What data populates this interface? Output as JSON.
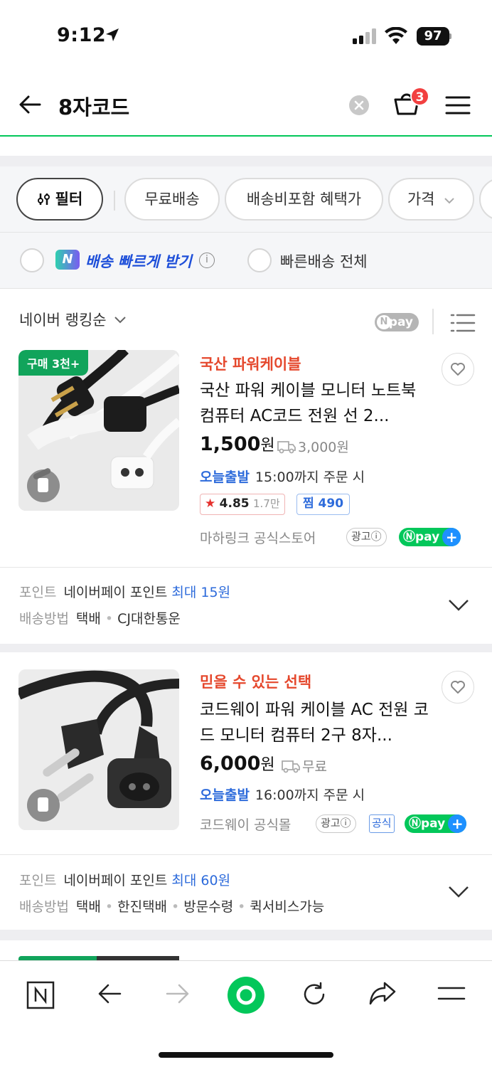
{
  "status_bar": {
    "time": "9:12",
    "battery": "97"
  },
  "header": {
    "query": "8자코드",
    "cart_count": "3"
  },
  "filters": {
    "filter_label": "필터",
    "chips": [
      "무료배송",
      "배송비포함 혜택가",
      "가격"
    ]
  },
  "fast_delivery": {
    "badge": "N",
    "option1_label": "배송 빠르게 받기",
    "option2_label": "빠른배송 전체"
  },
  "sort": {
    "label": "네이버 랭킹순",
    "npay_label": "pay"
  },
  "products": [
    {
      "badge": "구매 3천+",
      "tag": "국산 파워케이블",
      "title": "국산 파워 케이블 모니터 노트북 컴퓨터 AC코드 전원 선 2...",
      "price": "1,500",
      "price_unit": "원",
      "shipping": "3,000원",
      "dispatch_label": "오늘출발",
      "dispatch_detail": "15:00까지 주문 시",
      "rating": "4.85",
      "rating_count": "1.7만",
      "zzim_label": "찜 490",
      "store": "마하링크 공식스토어",
      "ad_label": "광고ⓘ",
      "npay_label": "pay",
      "point_key": "포인트",
      "point_text": "네이버페이 포인트",
      "point_max": "최대 15원",
      "delivery_key": "배송방법",
      "delivery_methods": [
        "택배",
        "CJ대한통운"
      ]
    },
    {
      "tag": "믿을 수 있는 선택",
      "title": "코드웨이 파워 케이블 AC 전원 코드 모니터 컴퓨터 2구 8자...",
      "price": "6,000",
      "price_unit": "원",
      "shipping": "무료",
      "dispatch_label": "오늘출발",
      "dispatch_detail": "16:00까지 주문 시",
      "store": "코드웨이 공식몰",
      "ad_label": "광고ⓘ",
      "official_label": "공식",
      "npay_label": "pay",
      "point_key": "포인트",
      "point_text": "네이버페이 포인트",
      "point_max": "최대 60원",
      "delivery_key": "배송방법",
      "delivery_methods": [
        "택배",
        "한진택배",
        "방문수령",
        "퀵서비스가능"
      ]
    }
  ],
  "colors": {
    "naver_green": "#03c75a",
    "accent_red": "#e5482d",
    "accent_blue": "#2d6bdb"
  }
}
